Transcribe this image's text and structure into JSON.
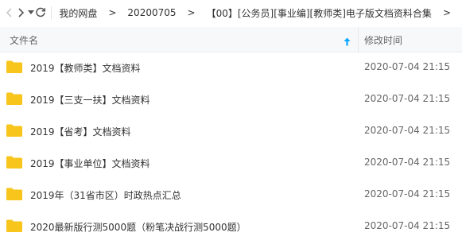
{
  "breadcrumb": [
    "我的网盘",
    "20200705",
    "【00】[公务员][事业编][教师类]电子版文档资料合集"
  ],
  "breadcrumb_separator": ">",
  "header": {
    "name_label": "文件名",
    "time_label": "修改时间"
  },
  "rows": [
    {
      "name": "2019【教师类】文档资料",
      "time": "2020-07-04 21:15"
    },
    {
      "name": "2019【三支一扶】文档资料",
      "time": "2020-07-04 21:15"
    },
    {
      "name": "2019【省考】文档资料",
      "time": "2020-07-04 21:15"
    },
    {
      "name": "2019【事业单位】文档资料",
      "time": "2020-07-04 21:15"
    },
    {
      "name": "2019年（31省市区）时政热点汇总",
      "time": "2020-07-04 21:15"
    },
    {
      "name": "2020最新版行测5000题（粉笔决战行测5000题）",
      "time": "2020-07-04 21:15"
    }
  ],
  "icons": {
    "back": "chevron-left-icon",
    "forward": "chevron-right-icon",
    "dropdown": "caret-down-icon",
    "refresh": "refresh-icon",
    "sort": "arrow-up-icon",
    "folder": "folder-icon"
  },
  "colors": {
    "folder": "#f8c51c",
    "accent": "#06a7ff"
  }
}
